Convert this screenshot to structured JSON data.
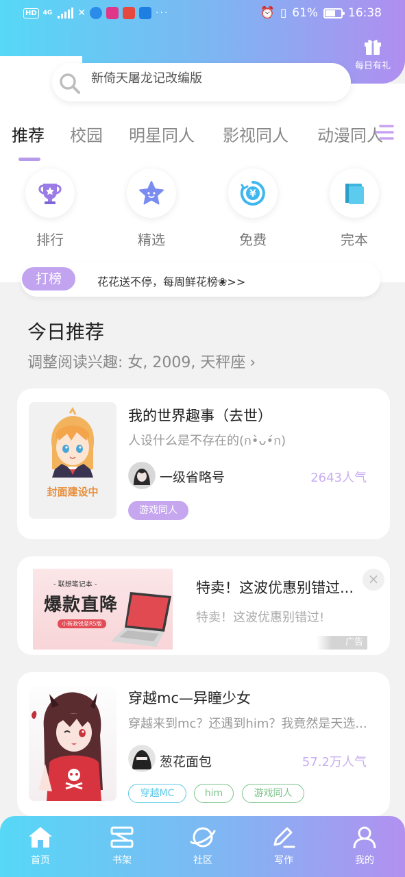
{
  "status_bar": {
    "hd": "HD",
    "network": "4G",
    "dots": "···",
    "battery": "61%",
    "time": "16:38"
  },
  "header": {
    "gift_label": "每日有礼",
    "search_text": "新倚天屠龙记改编版"
  },
  "tabs": [
    {
      "label": "推荐",
      "active": true
    },
    {
      "label": "校园"
    },
    {
      "label": "明星同人"
    },
    {
      "label": "影视同人"
    },
    {
      "label": "动漫同人"
    }
  ],
  "categories": [
    {
      "label": "排行",
      "icon": "trophy-icon"
    },
    {
      "label": "精选",
      "icon": "star-icon"
    },
    {
      "label": "免费",
      "icon": "yen-icon"
    },
    {
      "label": "完本",
      "icon": "book-icon"
    }
  ],
  "notice": {
    "badge": "打榜",
    "text": "花花送不停，每周鲜花榜❀>>"
  },
  "section": {
    "title": "今日推荐",
    "subtitle": "调整阅读兴趣: 女, 2009, 天秤座"
  },
  "books": [
    {
      "cover_caption": "封面建设中",
      "title": "我的世界趣事（去世）",
      "desc": "人设什么是不存在的(ก•̀ᴗ•́ก)",
      "author": "一级省略号",
      "popularity": "2643人气",
      "tags": [
        "游戏同人"
      ]
    },
    {
      "title": "穿越mc—异瞳少女",
      "desc": "穿越来到mc？还遇到him？我竟然是天选...",
      "author": "葱花面包",
      "popularity": "57.2万人气",
      "tags": [
        "穿越MC",
        "him",
        "游戏同人"
      ]
    }
  ],
  "ad": {
    "image_small": "- 联想笔记本 -",
    "image_big": "爆款直降",
    "image_pill": "小新政锐至R5版",
    "title": "特卖！这波优惠别错过...",
    "desc": "特卖！这波优惠别错过!",
    "label": "广告",
    "close": "×"
  },
  "bottom_nav": [
    {
      "label": "首页",
      "icon": "home-icon"
    },
    {
      "label": "书架",
      "icon": "bookshelf-icon"
    },
    {
      "label": "社区",
      "icon": "planet-icon"
    },
    {
      "label": "写作",
      "icon": "pencil-icon"
    },
    {
      "label": "我的",
      "icon": "user-icon"
    }
  ],
  "colors": {
    "accent_purple": "#b79bea",
    "gradient_start": "#56d8f6",
    "gradient_end": "#b08ef0",
    "tag_cyan": "#5ec9e8",
    "tag_green": "#7cc48a"
  }
}
